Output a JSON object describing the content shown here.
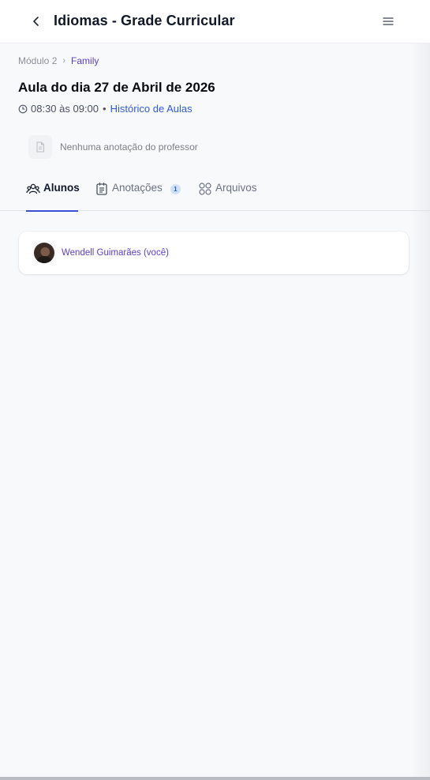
{
  "header": {
    "title": "Idiomas - Grade Curricular",
    "back_icon": "chevron-left-icon",
    "menu_icon": "hamburger-menu-icon"
  },
  "breadcrumb": {
    "items": [
      "Módulo 2",
      "Family"
    ],
    "separator": "›"
  },
  "lesson": {
    "title": "Aula do dia 27 de Abril de 2026",
    "time": "08:30 às 09:00",
    "separator": "•",
    "history_link": "Histórico de Aulas"
  },
  "teacher_note": {
    "text": "Nenhuma anotação do professor",
    "icon": "document-icon"
  },
  "tabs": [
    {
      "label": "Alunos",
      "icon": "users-icon",
      "active": true
    },
    {
      "label": "Anotações",
      "icon": "clipboard-icon",
      "active": false,
      "badge": "1"
    },
    {
      "label": "Arquivos",
      "icon": "grid-icon",
      "active": false
    }
  ],
  "students": [
    {
      "name": "Wendell Guimarães (você)"
    }
  ],
  "colors": {
    "accent": "#3b4fd8",
    "link": "#2f5bd8",
    "breadcrumb_active": "#5b3ec9",
    "student_name": "#5b3ec9",
    "background": "#f8f9fb"
  }
}
